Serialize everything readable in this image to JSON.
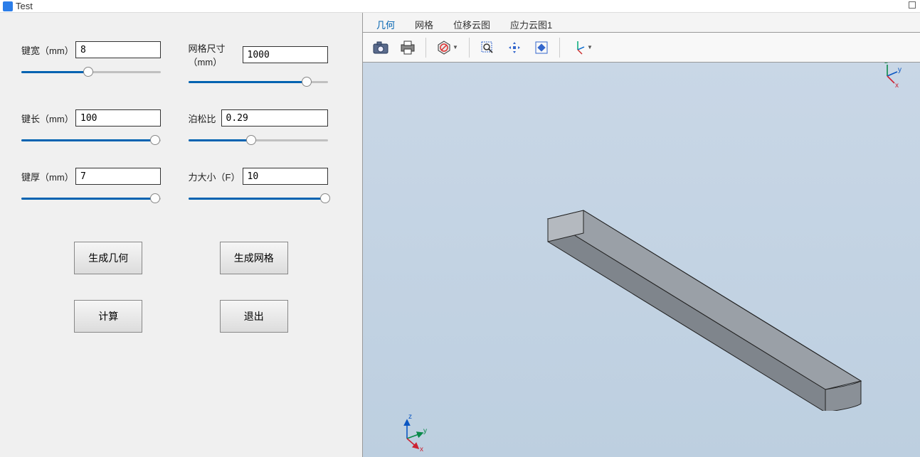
{
  "window": {
    "title": "Test"
  },
  "params": {
    "width": {
      "label": "键宽（mm）",
      "value": "8",
      "slider_pct": 48,
      "name": "key-width"
    },
    "meshsize": {
      "label": "网格尺寸（mm）",
      "value": "1000",
      "slider_pct": 85,
      "name": "mesh-size"
    },
    "length": {
      "label": "键长（mm）",
      "value": "100",
      "slider_pct": 96,
      "name": "key-length"
    },
    "poisson": {
      "label": "泊松比",
      "value": "0.29",
      "slider_pct": 45,
      "name": "poisson-ratio"
    },
    "thickness": {
      "label": "键厚（mm）",
      "value": "7",
      "slider_pct": 96,
      "name": "key-thickness"
    },
    "force": {
      "label": "力大小（F）",
      "value": "10",
      "slider_pct": 98,
      "name": "force-magnitude"
    }
  },
  "buttons": {
    "gen_geom": "生成几何",
    "gen_mesh": "生成网格",
    "compute": "计算",
    "exit": "退出"
  },
  "tabs": {
    "geom": "几何",
    "mesh": "网格",
    "disp": "位移云图",
    "stress": "应力云图1",
    "active": "geom"
  },
  "tools": {
    "snapshot": "camera-icon",
    "print": "print-icon",
    "shading": "shading-mode-icon",
    "zoom": "zoom-to-box-icon",
    "pan": "pan-icon",
    "fit": "fit-window-icon",
    "orient": "axis-orient-icon"
  },
  "axes": {
    "x": "x",
    "y": "y",
    "z": "z"
  }
}
